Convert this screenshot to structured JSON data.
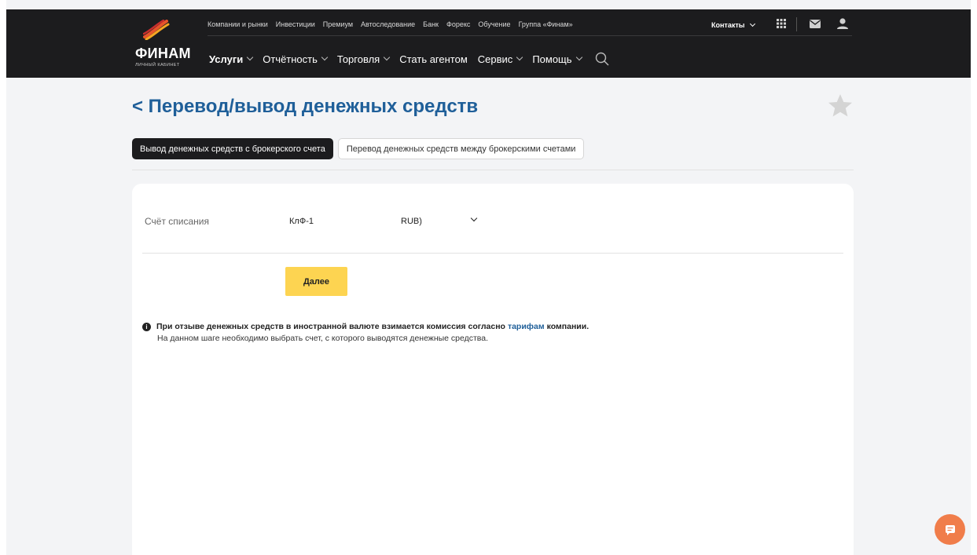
{
  "header": {
    "logo_text": "ФИНАМ",
    "logo_subtitle": "ЛИЧНЫЙ КАБИНЕТ",
    "top_nav": [
      "Компании и рынки",
      "Инвестиции",
      "Премиум",
      "Автоследование",
      "Банк",
      "Форекс",
      "Обучение",
      "Группа «Финам»"
    ],
    "contacts_label": "Контакты",
    "main_nav": [
      {
        "label": "Услуги",
        "active": true
      },
      {
        "label": "Отчётность"
      },
      {
        "label": "Торговля"
      },
      {
        "label": "Стать агентом"
      },
      {
        "label": "Сервис"
      },
      {
        "label": "Помощь"
      }
    ],
    "icons": [
      "apps-grid-icon",
      "mail-icon",
      "user-icon",
      "search-icon"
    ]
  },
  "page": {
    "title": "< Перевод/вывод денежных средств",
    "favorite_icon": "star-icon"
  },
  "tabs": [
    {
      "label": "Вывод денежных средств с брокерского счета",
      "active": true
    },
    {
      "label": "Перевод денежных средств между брокерскими счетами",
      "active": false
    }
  ],
  "form": {
    "account_label": "Счёт списания",
    "account_value": "КлФ-1",
    "currency_value": "RUB)",
    "next_button": "Далее"
  },
  "notice": {
    "bold_before_link": "При отзыве денежных средств в иностранной валюте взимается комиссия согласно",
    "link_text": "тарифам",
    "bold_after_link": "компании.",
    "info_text": "На данном шаге необходимо выбрать счет, с которого выводятся денежные средства."
  },
  "colors": {
    "header_bg": "#1c1c1e",
    "title_blue": "#1f5f99",
    "button_yellow": "#fdd451",
    "chat_orange": "#f07d4a"
  }
}
